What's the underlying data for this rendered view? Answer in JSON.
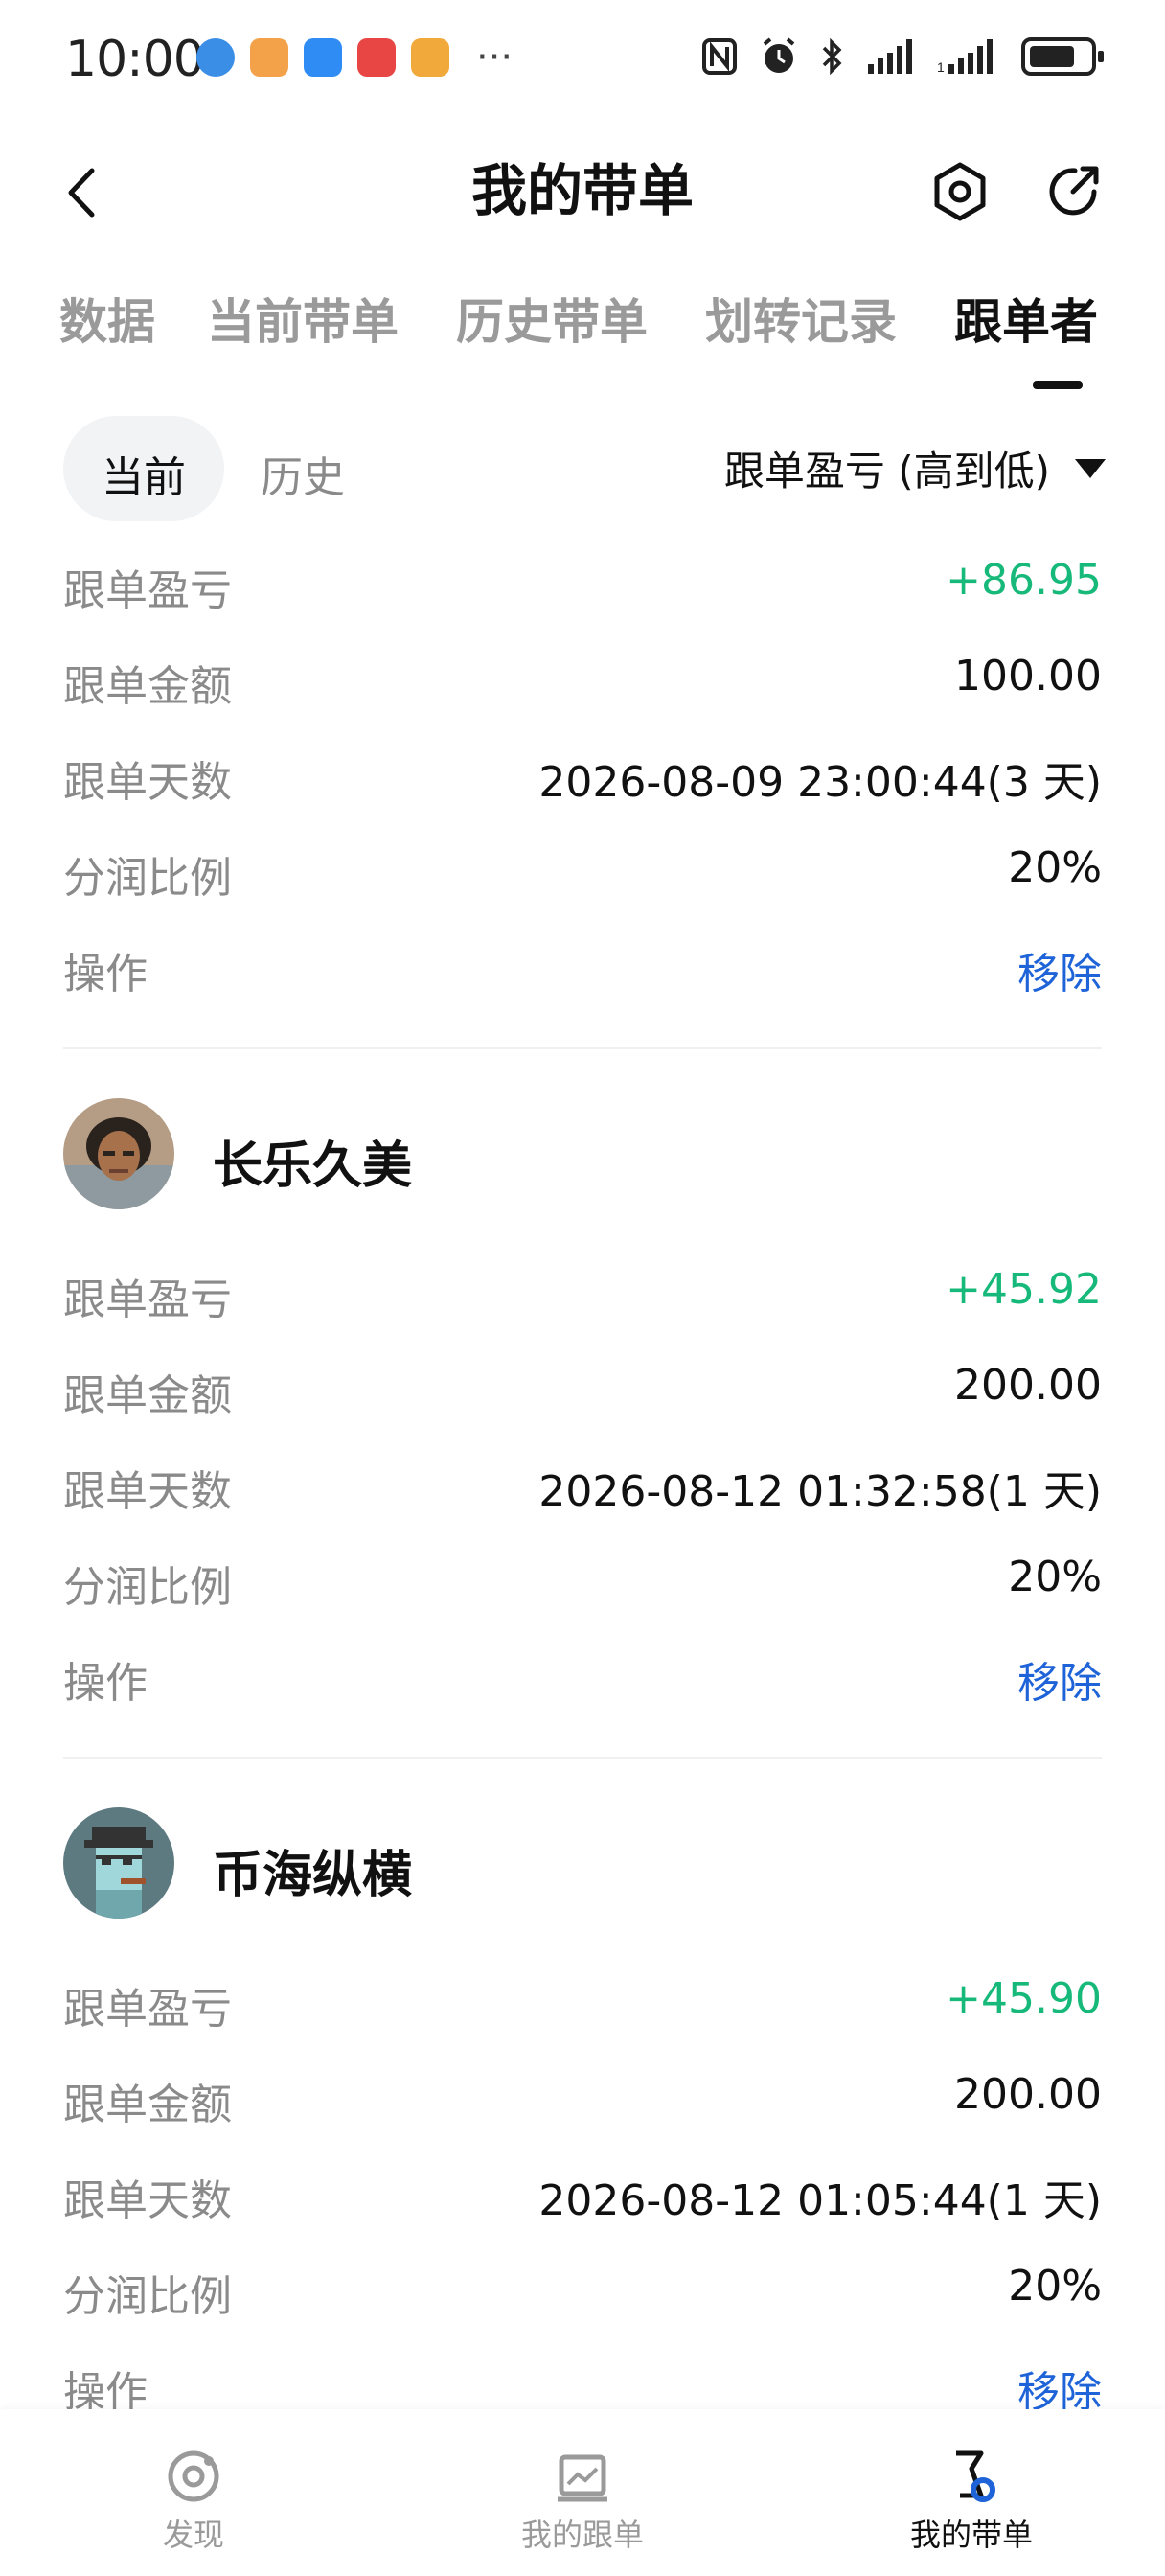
{
  "status_bar": {
    "time": "10:00",
    "more": "···"
  },
  "header": {
    "title": "我的带单"
  },
  "tabs": [
    {
      "label": "数据",
      "active": false
    },
    {
      "label": "当前带单",
      "active": false
    },
    {
      "label": "历史带单",
      "active": false
    },
    {
      "label": "划转记录",
      "active": false
    },
    {
      "label": "跟单者",
      "active": true
    }
  ],
  "subtabs": {
    "current": "当前",
    "history": "历史",
    "sort_label": "跟单盈亏 (高到低)"
  },
  "labels": {
    "pnl": "跟单盈亏",
    "amount": "跟单金额",
    "days": "跟单天数",
    "share": "分润比例",
    "action": "操作"
  },
  "followers": [
    {
      "name": "",
      "pnl": "+86.95",
      "amount": "100.00",
      "days": "2026-08-09 23:00:44(3 天)",
      "share": "20%",
      "action": "移除"
    },
    {
      "name": "长乐久美",
      "pnl": "+45.92",
      "amount": "200.00",
      "days": "2026-08-12 01:32:58(1 天)",
      "share": "20%",
      "action": "移除"
    },
    {
      "name": "币海纵横",
      "pnl": "+45.90",
      "amount": "200.00",
      "days": "2026-08-12 01:05:44(1 天)",
      "share": "20%",
      "action": "移除"
    }
  ],
  "bottom_nav": [
    {
      "label": "发现",
      "icon": "discover-icon",
      "active": false
    },
    {
      "label": "我的跟单",
      "icon": "chart-icon",
      "active": false
    },
    {
      "label": "我的带单",
      "icon": "lead-trade-icon",
      "active": true
    }
  ],
  "colors": {
    "positive": "#16b979",
    "link": "#1e64d8",
    "accent": "#1e64d8"
  }
}
